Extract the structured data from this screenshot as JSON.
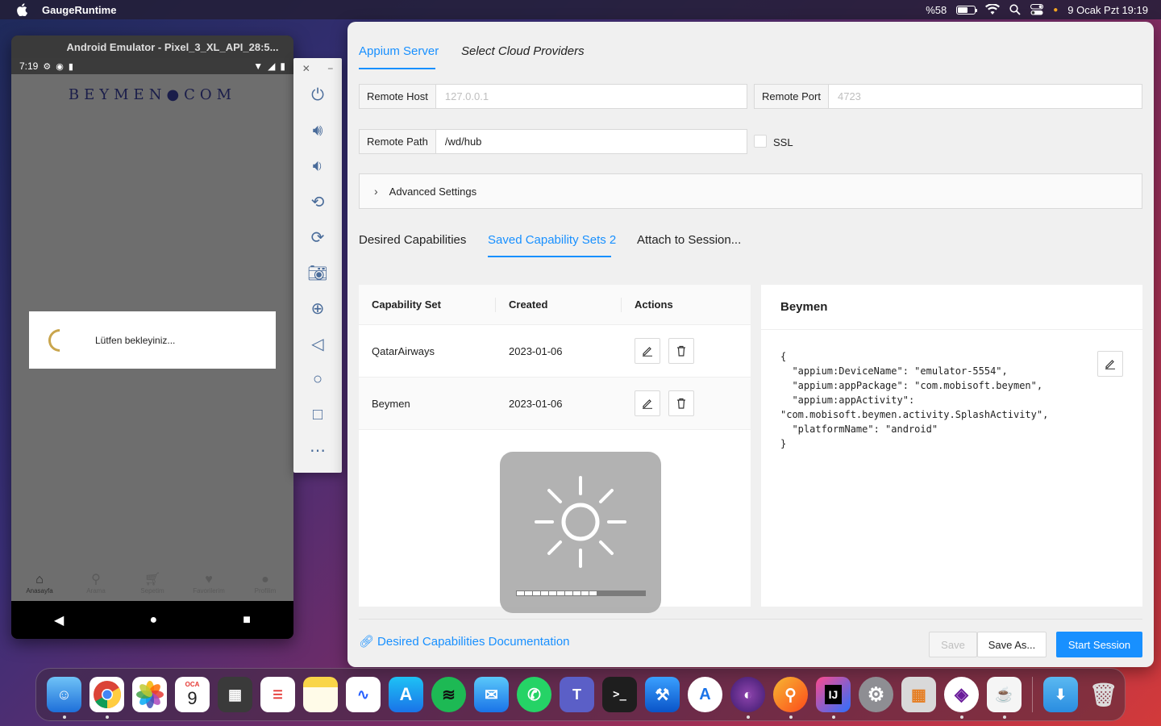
{
  "menubar": {
    "app_name": "GaugeRuntime",
    "battery_text": "%58",
    "battery_level": 0.58,
    "datetime": "9 Ocak Pzt  19:19"
  },
  "emulator": {
    "title": "Android Emulator - Pixel_3_XL_API_28:5...",
    "status_time": "7:19",
    "logo": "BEYMEN●COM",
    "dialog_text": "Lütfen bekleyiniz...",
    "tabs": [
      {
        "label": "Anasayfa",
        "icon": "home-icon"
      },
      {
        "label": "Arama",
        "icon": "search-icon"
      },
      {
        "label": "Sepetim",
        "icon": "cart-icon"
      },
      {
        "label": "Favorilerim",
        "icon": "heart-icon"
      },
      {
        "label": "Profilim",
        "icon": "profile-icon"
      }
    ]
  },
  "appium": {
    "tabs": [
      "Appium Server",
      "Select Cloud Providers"
    ],
    "remote_host": {
      "label": "Remote Host",
      "placeholder": "127.0.0.1"
    },
    "remote_port": {
      "label": "Remote Port",
      "placeholder": "4723"
    },
    "remote_path": {
      "label": "Remote Path",
      "value": "/wd/hub"
    },
    "ssl_label": "SSL",
    "advanced_label": "Advanced Settings",
    "subtabs": [
      "Desired Capabilities",
      "Saved Capability Sets 2",
      "Attach to Session..."
    ],
    "table": {
      "headers": [
        "Capability Set",
        "Created",
        "Actions"
      ],
      "rows": [
        {
          "name": "QatarAirways",
          "created": "2023-01-06"
        },
        {
          "name": "Beymen",
          "created": "2023-01-06"
        }
      ]
    },
    "detail": {
      "title": "Beymen",
      "json": "{\n  \"appium:DeviceName\": \"emulator-5554\",\n  \"appium:appPackage\": \"com.mobisoft.beymen\",\n  \"appium:appActivity\":\n\"com.mobisoft.beymen.activity.SplashActivity\",\n  \"platformName\": \"android\"\n}"
    },
    "doc_link": "Desired Capabilities Documentation",
    "buttons": {
      "save": "Save",
      "save_as": "Save As...",
      "start": "Start Session"
    },
    "accent": "#1890ff"
  },
  "brightness_hud": {
    "level": 0.625
  },
  "dock": [
    "Finder",
    "Chrome",
    "Photos",
    "Calendar",
    "Calculator",
    "Reminders",
    "Notes",
    "Freeform",
    "App Store",
    "Spotify",
    "Mail",
    "WhatsApp",
    "Teams",
    "Terminal",
    "Xcode",
    "Android Studio",
    "Eclipse",
    "Inspector",
    "IntelliJ IDEA",
    "System Settings",
    "Launchpad",
    "Appium",
    "Java",
    "Downloads",
    "Trash"
  ],
  "calendar": {
    "month": "OCA",
    "day": "9"
  }
}
